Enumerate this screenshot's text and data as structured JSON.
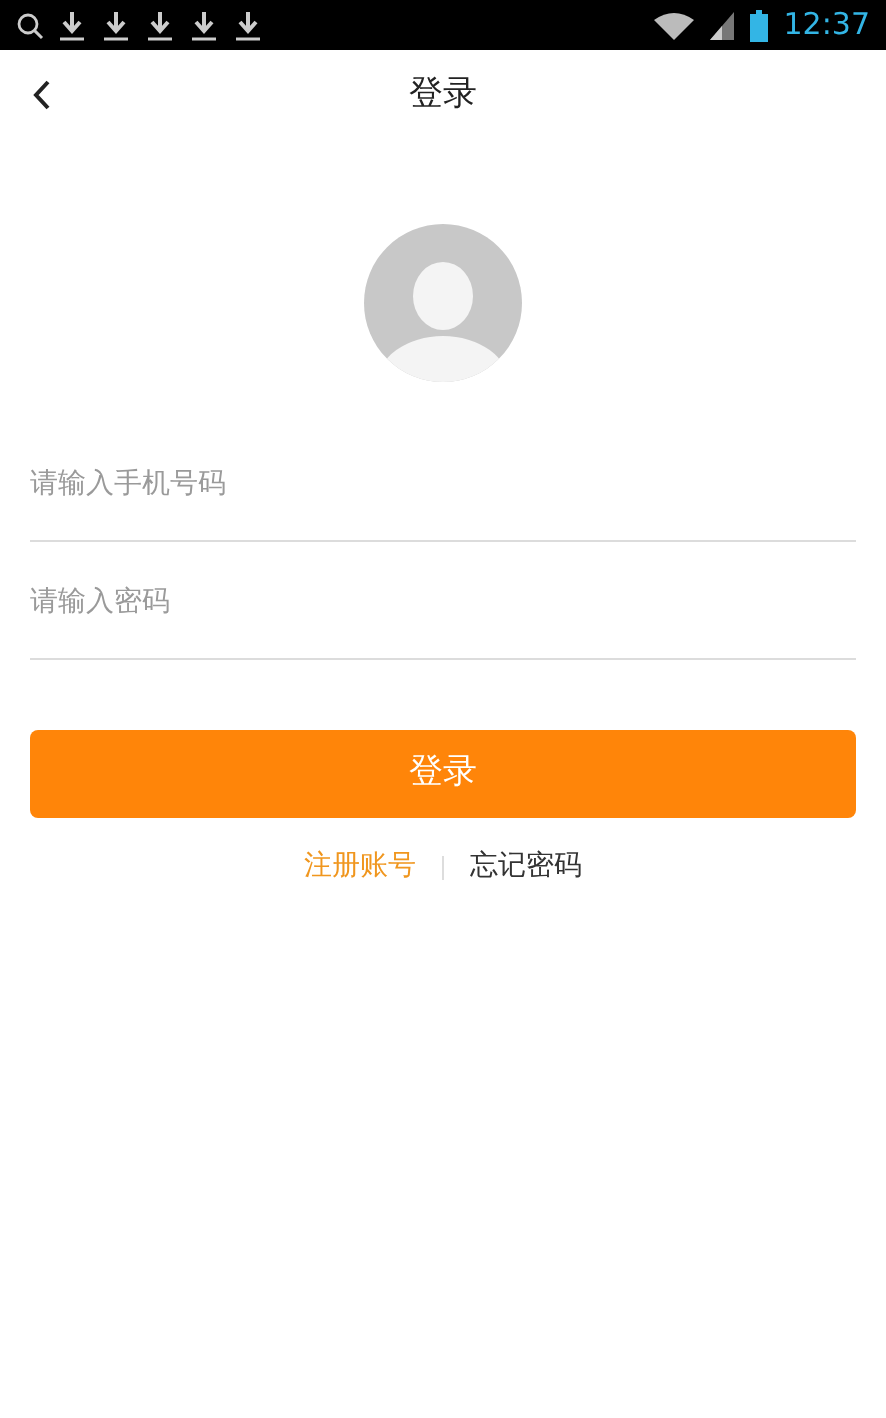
{
  "status_bar": {
    "time": "12:37"
  },
  "header": {
    "title": "登录"
  },
  "form": {
    "fields": [
      {
        "placeholder": "请输入手机号码"
      },
      {
        "placeholder": "请输入密码"
      }
    ],
    "submit": "登录"
  },
  "links": [
    {
      "label": "注册账号",
      "kind": "primary"
    },
    {
      "label": "忘记密码",
      "kind": "plain"
    }
  ]
}
